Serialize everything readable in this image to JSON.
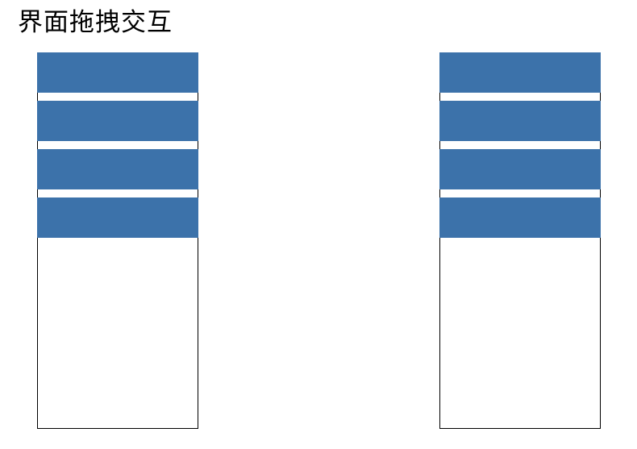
{
  "page": {
    "title": "界面拖拽交互"
  },
  "colors": {
    "item_fill": "#3c72aa",
    "column_border": "#000000",
    "background": "#ffffff"
  },
  "columns": [
    {
      "id": "left",
      "item_count": 4
    },
    {
      "id": "right",
      "item_count": 4
    }
  ]
}
